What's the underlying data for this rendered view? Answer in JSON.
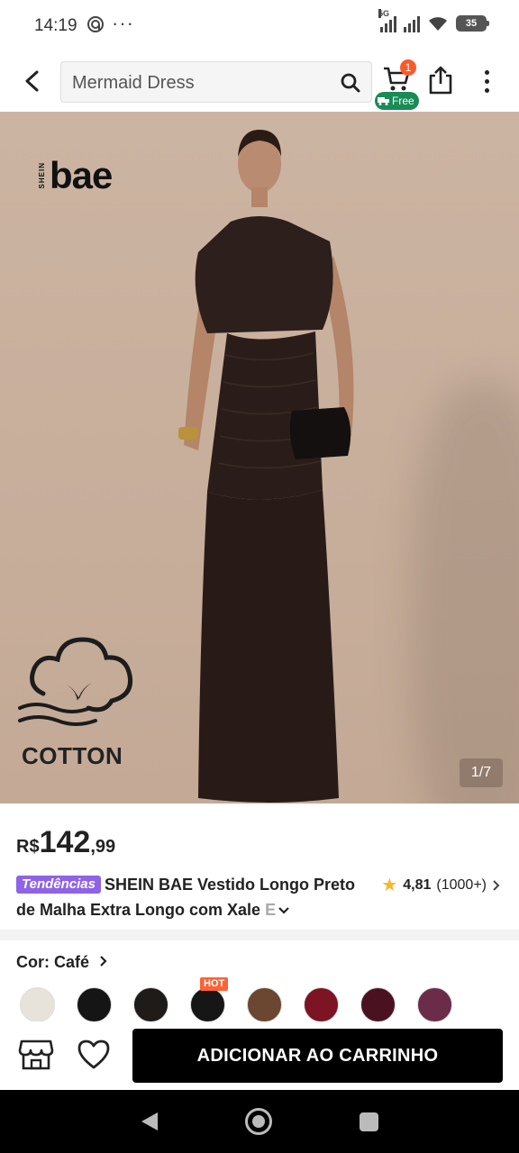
{
  "status_bar": {
    "time": "14:19",
    "network_type": "5G",
    "battery": "35"
  },
  "header": {
    "search_placeholder": "Mermaid Dress",
    "cart_count": "1",
    "free_label": "Free"
  },
  "hero": {
    "brand_small": "SHEIN",
    "brand_big": "bae",
    "cotton_label": "COTTON",
    "image_counter": "1/7"
  },
  "product": {
    "currency": "R$",
    "price_int": "142",
    "price_dec": ",99",
    "trend_tag": "Tendências",
    "title_main": "SHEIN BAE Vestido Longo Preto de Malha Extra Longo com Xale",
    "title_fade": " E",
    "rating": "4,81",
    "review_count": "(1000+)"
  },
  "color_selector": {
    "label": "Cor: Café",
    "hot_label": "HOT",
    "swatches": [
      "#e8e3da",
      "#151515",
      "#1e1b19",
      "#161616",
      "#6b4630",
      "#7c1424",
      "#4a1220",
      "#6a2c48"
    ]
  },
  "actions": {
    "add_to_cart": "ADICIONAR AO CARRINHO"
  },
  "colors": {
    "accent_orange": "#fa5a2a",
    "free_green": "#198b57",
    "trend_purple": "#8f63e6",
    "star_yellow": "#f8b62a"
  }
}
